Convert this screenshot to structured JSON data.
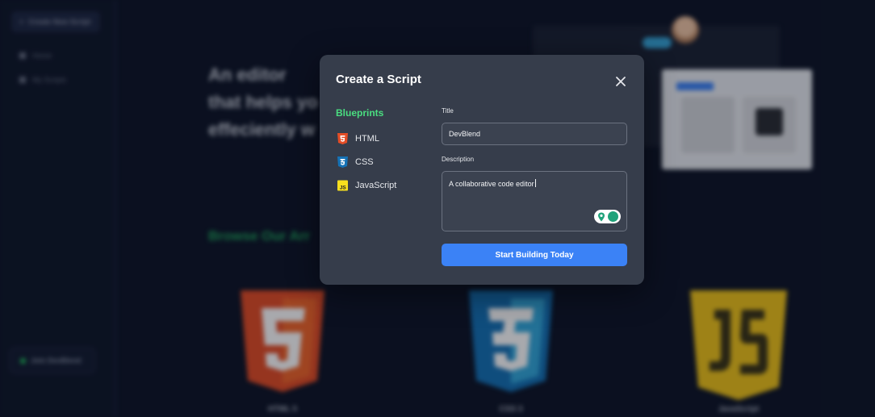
{
  "background": {
    "sidebar": {
      "create_button": "Create New Script",
      "items": [
        {
          "label": "Home",
          "icon": "home-icon"
        },
        {
          "label": "My Scripts",
          "icon": "folder-icon"
        }
      ],
      "join_button": "Join DevBlend"
    },
    "hero": {
      "line1": "An editor",
      "line2": "that helps yo",
      "line3": "effeciently w"
    },
    "browse_heading": "Browse Our Arr",
    "languages": [
      {
        "label": "HTML 5",
        "color": "#e44d26"
      },
      {
        "label": "CSS 3",
        "color": "#1b73ba"
      },
      {
        "label": "JavaScript",
        "color": "#f0c419"
      }
    ]
  },
  "modal": {
    "title": "Create a Script",
    "close_icon": "close-icon",
    "blueprints": {
      "heading": "Blueprints",
      "items": [
        {
          "label": "HTML",
          "icon": "html5-icon",
          "color": "#e44d26"
        },
        {
          "label": "CSS",
          "icon": "css3-icon",
          "color": "#1572b6"
        },
        {
          "label": "JavaScript",
          "icon": "javascript-icon",
          "color": "#f7df1e"
        }
      ]
    },
    "form": {
      "title_label": "Title",
      "title_value": "DevBlend",
      "description_label": "Description",
      "description_value": "A collaborative code editor",
      "submit_label": "Start Building Today"
    }
  },
  "colors": {
    "accent_blue": "#3b82f6",
    "accent_green": "#4ade80",
    "modal_bg": "#363d4b",
    "page_bg": "#0e1527"
  }
}
